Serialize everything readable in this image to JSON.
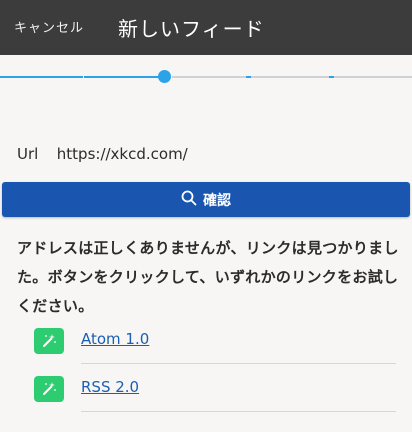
{
  "header": {
    "cancel_label": "キャンセル",
    "title": "新しいフィード"
  },
  "stepper": {
    "active_step": 3,
    "total_steps": 5
  },
  "form": {
    "url_label": "Url",
    "url_value": "https://xkcd.com/"
  },
  "confirm_button": {
    "label": "確認",
    "icon": "search-icon"
  },
  "message": "アドレスは正しくありませんが、リンクは見つかりました。ボタンをクリックして、いずれかのリンクをお試しください。",
  "feeds": [
    {
      "label": "Atom 1.0",
      "icon": "magic-wand-icon"
    },
    {
      "label": "RSS 2.0",
      "icon": "magic-wand-icon"
    }
  ],
  "colors": {
    "appbar": "#3c3c3c",
    "accent": "#2aa3e8",
    "track": "#cfd2d6",
    "button": "#1a56b0",
    "feed_icon": "#2ecc71",
    "link": "#1a5fb4"
  }
}
